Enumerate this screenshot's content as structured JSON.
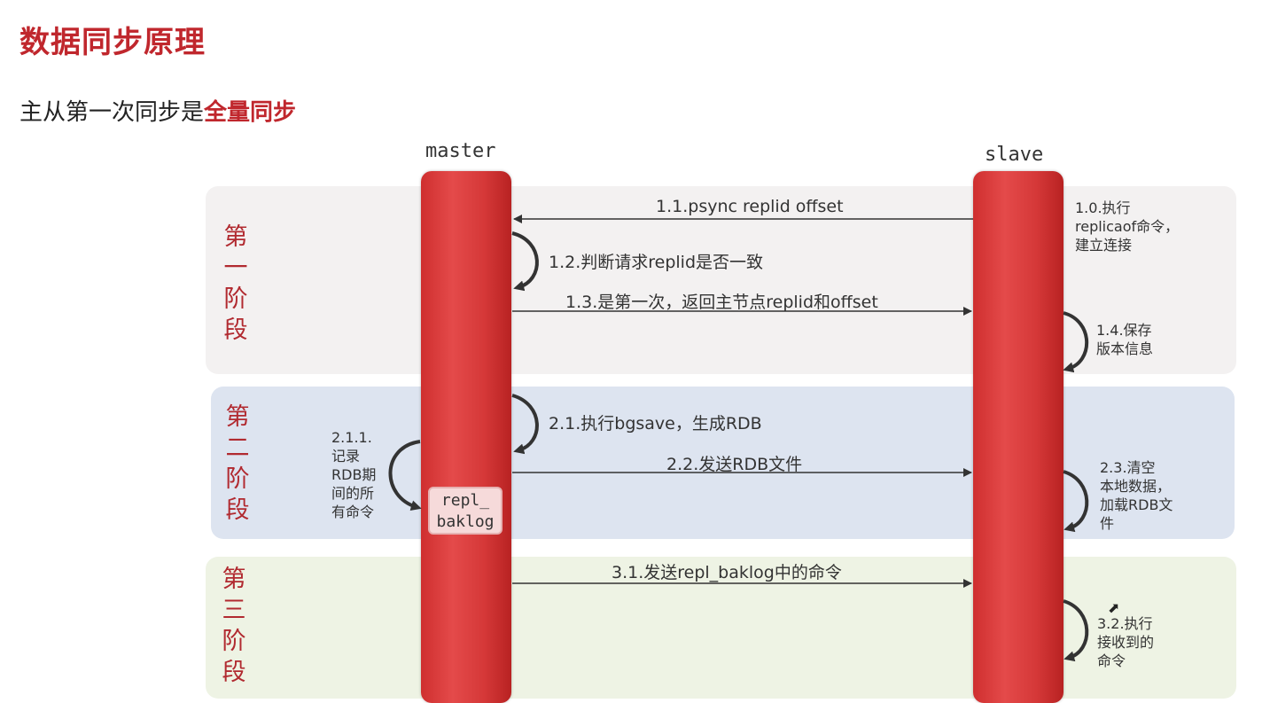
{
  "title": "数据同步原理",
  "subtitle": {
    "prefix": "主从第一次同步是",
    "highlight": "全量同步"
  },
  "lanes": {
    "master": "master",
    "slave": "slave"
  },
  "phases": [
    {
      "chars": [
        "第",
        "一",
        "阶",
        "段"
      ]
    },
    {
      "chars": [
        "第",
        "二",
        "阶",
        "段"
      ]
    },
    {
      "chars": [
        "第",
        "三",
        "阶",
        "段"
      ]
    }
  ],
  "messages": {
    "m1_1": "1.1.psync replid offset",
    "m1_2": "1.2.判断请求replid是否一致",
    "m1_3": "1.3.是第一次，返回主节点replid和offset",
    "m2_1": "2.1.执行bgsave，生成RDB",
    "m2_2": "2.2.发送RDB文件",
    "m3_1": "3.1.发送repl_baklog中的命令"
  },
  "notes": {
    "n1_0": [
      "1.0.执行",
      "replicaof命令，",
      "建立连接"
    ],
    "n1_4": [
      "1.4.保存",
      "版本信息"
    ],
    "n2_1_1": [
      "2.1.1.",
      "记录",
      "RDB期",
      "间的所",
      "有命令"
    ],
    "n2_3": [
      "2.3.清空",
      "本地数据，",
      "加载RDB文",
      "件"
    ],
    "n3_2": [
      "3.2.执行",
      "接收到的",
      "命令"
    ]
  },
  "buffer": [
    "repl_",
    "baklog"
  ],
  "colors": {
    "accent": "#c0272d",
    "lifeline": "#d53838",
    "phase1_bg": "#f3f1f1",
    "phase2_bg": "#dde4f0",
    "phase3_bg": "#eef3e4"
  }
}
